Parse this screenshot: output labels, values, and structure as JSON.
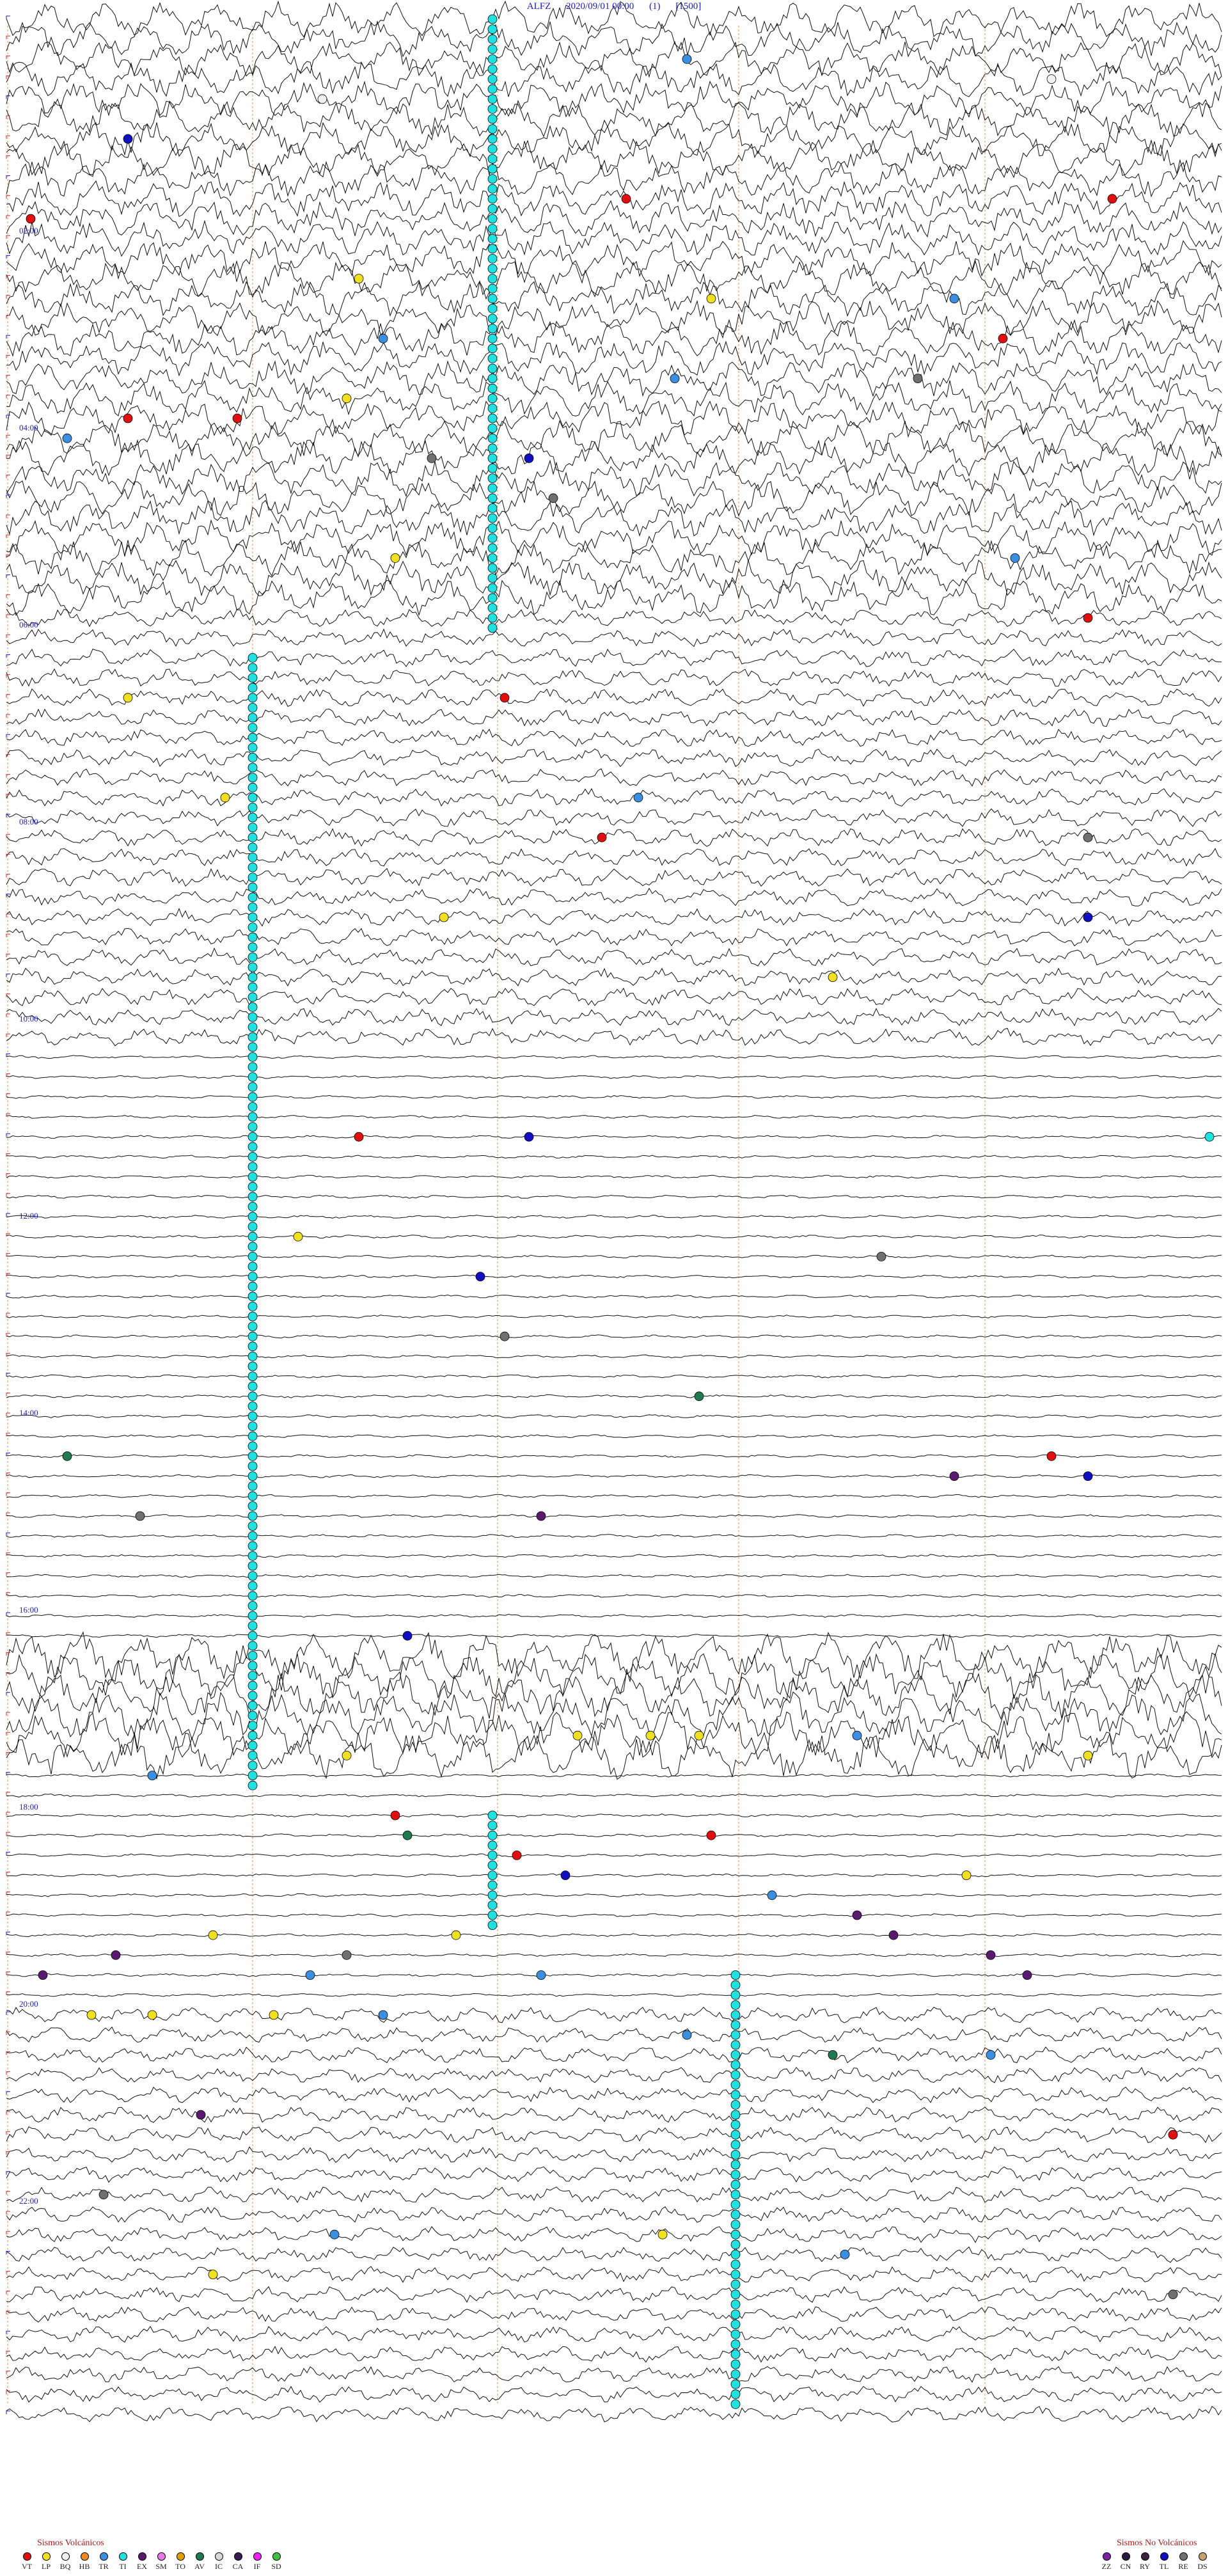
{
  "header": {
    "station": "ALFZ",
    "datetime": "2020/09/01 00:00",
    "channel": "(1)",
    "scale": "[1500]"
  },
  "chart_data": {
    "type": "helicorder",
    "rows": 96,
    "row_minutes": 15,
    "hour_labels": [
      "02:00",
      "04:00",
      "06:00",
      "08:00",
      "10:00",
      "12:00",
      "14:00",
      "16:00",
      "18:00",
      "20:00",
      "22:00"
    ],
    "marker_columns": 4,
    "event_colors": {
      "VT": "#e01010",
      "LP": "#f0e020",
      "BQ": "#f0f0f0",
      "HB": "#f08a20",
      "TR": "#3b8fe0",
      "TI": "#20e0e0",
      "EX": "#5a1a70",
      "SM": "#e878e8",
      "TO": "#e0a000",
      "AV": "#207a50",
      "IC": "#d8d8d8",
      "CA": "#3a1a50",
      "IF": "#f020f0",
      "SD": "#40c040",
      "ZZ": "#7a20a0",
      "CN": "#2a1a40",
      "RY": "#402040",
      "TL": "#1010c0",
      "RE": "#707070",
      "DS": "#c8a070"
    },
    "traces": [
      {
        "rows": [
          0,
          30
        ],
        "amp": 0.9
      },
      {
        "rows": [
          30,
          52
        ],
        "amp": 0.45
      },
      {
        "rows": [
          52,
          82
        ],
        "amp": 0.08
      },
      {
        "rows": [
          82,
          88
        ],
        "amp": 1.2
      },
      {
        "rows": [
          88,
          100
        ],
        "amp": 0.08
      },
      {
        "rows": [
          100,
          122
        ],
        "amp": 0.4
      }
    ],
    "cyan_runs": [
      {
        "rows": [
          0,
          31
        ],
        "col": 2
      },
      {
        "rows": [
          32,
          89
        ],
        "col": 1
      },
      {
        "rows": [
          90,
          96
        ],
        "col": 2
      },
      {
        "rows": [
          98,
          120
        ],
        "col": 3
      }
    ],
    "events": [
      {
        "row": 2,
        "t": 0.56,
        "c": "TR"
      },
      {
        "row": 3,
        "t": 0.86,
        "c": "BQ"
      },
      {
        "row": 4,
        "t": 0.26,
        "c": "BQ"
      },
      {
        "row": 6,
        "t": 0.1,
        "c": "TL"
      },
      {
        "row": 9,
        "t": 0.51,
        "c": "VT"
      },
      {
        "row": 9,
        "t": 0.91,
        "c": "VT"
      },
      {
        "row": 10,
        "t": 0.02,
        "c": "VT"
      },
      {
        "row": 13,
        "t": 0.29,
        "c": "LP"
      },
      {
        "row": 14,
        "t": 0.58,
        "c": "LP"
      },
      {
        "row": 14,
        "t": 0.78,
        "c": "TR"
      },
      {
        "row": 16,
        "t": 0.31,
        "c": "TR"
      },
      {
        "row": 16,
        "t": 0.82,
        "c": "VT"
      },
      {
        "row": 18,
        "t": 0.55,
        "c": "TR"
      },
      {
        "row": 18,
        "t": 0.75,
        "c": "RE"
      },
      {
        "row": 19,
        "t": 0.28,
        "c": "LP"
      },
      {
        "row": 20,
        "t": 0.1,
        "c": "VT"
      },
      {
        "row": 20,
        "t": 0.19,
        "c": "VT"
      },
      {
        "row": 21,
        "t": 0.05,
        "c": "TR"
      },
      {
        "row": 22,
        "t": 0.43,
        "c": "TL"
      },
      {
        "row": 22,
        "t": 0.35,
        "c": "RE"
      },
      {
        "row": 24,
        "t": 0.45,
        "c": "RE"
      },
      {
        "row": 27,
        "t": 0.32,
        "c": "LP"
      },
      {
        "row": 27,
        "t": 0.83,
        "c": "TR"
      },
      {
        "row": 30,
        "t": 0.89,
        "c": "VT"
      },
      {
        "row": 34,
        "t": 0.1,
        "c": "LP"
      },
      {
        "row": 34,
        "t": 0.41,
        "c": "VT"
      },
      {
        "row": 39,
        "t": 0.18,
        "c": "LP"
      },
      {
        "row": 39,
        "t": 0.52,
        "c": "TR"
      },
      {
        "row": 41,
        "t": 0.49,
        "c": "VT"
      },
      {
        "row": 41,
        "t": 0.89,
        "c": "RE"
      },
      {
        "row": 45,
        "t": 0.36,
        "c": "LP"
      },
      {
        "row": 45,
        "t": 0.89,
        "c": "TL"
      },
      {
        "row": 48,
        "t": 0.68,
        "c": "LP"
      },
      {
        "row": 56,
        "t": 0.29,
        "c": "VT"
      },
      {
        "row": 56,
        "t": 0.43,
        "c": "TL"
      },
      {
        "row": 56,
        "t": 0.99,
        "c": "TI"
      },
      {
        "row": 61,
        "t": 0.24,
        "c": "LP"
      },
      {
        "row": 62,
        "t": 0.72,
        "c": "RE"
      },
      {
        "row": 63,
        "t": 0.39,
        "c": "TL"
      },
      {
        "row": 66,
        "t": 0.41,
        "c": "RE"
      },
      {
        "row": 69,
        "t": 0.57,
        "c": "AV"
      },
      {
        "row": 72,
        "t": 0.05,
        "c": "AV"
      },
      {
        "row": 72,
        "t": 0.86,
        "c": "VT"
      },
      {
        "row": 73,
        "t": 0.78,
        "c": "EX"
      },
      {
        "row": 73,
        "t": 0.89,
        "c": "TL"
      },
      {
        "row": 75,
        "t": 0.11,
        "c": "RE"
      },
      {
        "row": 75,
        "t": 0.44,
        "c": "EX"
      },
      {
        "row": 81,
        "t": 0.33,
        "c": "TL"
      },
      {
        "row": 86,
        "t": 0.47,
        "c": "LP"
      },
      {
        "row": 86,
        "t": 0.53,
        "c": "LP"
      },
      {
        "row": 86,
        "t": 0.57,
        "c": "LP"
      },
      {
        "row": 86,
        "t": 0.7,
        "c": "TR"
      },
      {
        "row": 87,
        "t": 0.28,
        "c": "LP"
      },
      {
        "row": 87,
        "t": 0.89,
        "c": "LP"
      },
      {
        "row": 88,
        "t": 0.12,
        "c": "TR"
      },
      {
        "row": 90,
        "t": 0.32,
        "c": "VT"
      },
      {
        "row": 91,
        "t": 0.58,
        "c": "VT"
      },
      {
        "row": 91,
        "t": 0.33,
        "c": "AV"
      },
      {
        "row": 92,
        "t": 0.42,
        "c": "VT"
      },
      {
        "row": 93,
        "t": 0.46,
        "c": "TL"
      },
      {
        "row": 93,
        "t": 0.79,
        "c": "LP"
      },
      {
        "row": 94,
        "t": 0.63,
        "c": "TR"
      },
      {
        "row": 95,
        "t": 0.7,
        "c": "EX"
      },
      {
        "row": 96,
        "t": 0.17,
        "c": "LP"
      },
      {
        "row": 96,
        "t": 0.37,
        "c": "LP"
      },
      {
        "row": 96,
        "t": 0.73,
        "c": "EX"
      },
      {
        "row": 97,
        "t": 0.09,
        "c": "EX"
      },
      {
        "row": 97,
        "t": 0.28,
        "c": "RE"
      },
      {
        "row": 97,
        "t": 0.81,
        "c": "EX"
      },
      {
        "row": 98,
        "t": 0.03,
        "c": "EX"
      },
      {
        "row": 98,
        "t": 0.25,
        "c": "TR"
      },
      {
        "row": 98,
        "t": 0.44,
        "c": "TR"
      },
      {
        "row": 98,
        "t": 0.84,
        "c": "EX"
      },
      {
        "row": 100,
        "t": 0.07,
        "c": "LP"
      },
      {
        "row": 100,
        "t": 0.12,
        "c": "LP"
      },
      {
        "row": 100,
        "t": 0.22,
        "c": "LP"
      },
      {
        "row": 100,
        "t": 0.31,
        "c": "TR"
      },
      {
        "row": 101,
        "t": 0.56,
        "c": "TR"
      },
      {
        "row": 102,
        "t": 0.68,
        "c": "AV"
      },
      {
        "row": 102,
        "t": 0.81,
        "c": "TR"
      },
      {
        "row": 105,
        "t": 0.16,
        "c": "EX"
      },
      {
        "row": 106,
        "t": 0.96,
        "c": "VT"
      },
      {
        "row": 109,
        "t": 0.08,
        "c": "RE"
      },
      {
        "row": 111,
        "t": 0.27,
        "c": "TR"
      },
      {
        "row": 111,
        "t": 0.54,
        "c": "LP"
      },
      {
        "row": 112,
        "t": 0.69,
        "c": "TR"
      },
      {
        "row": 113,
        "t": 0.17,
        "c": "LP"
      },
      {
        "row": 114,
        "t": 0.96,
        "c": "RE"
      }
    ]
  },
  "legend_volcanic": {
    "title": "Sismos Volcánicos",
    "items": [
      {
        "code": "VT",
        "color": "#e01010"
      },
      {
        "code": "LP",
        "color": "#f0e020"
      },
      {
        "code": "BQ",
        "color": "#f0f0f0"
      },
      {
        "code": "HB",
        "color": "#f08a20"
      },
      {
        "code": "TR",
        "color": "#3b8fe0"
      },
      {
        "code": "TI",
        "color": "#20e0e0"
      },
      {
        "code": "EX",
        "color": "#5a1a70"
      },
      {
        "code": "SM",
        "color": "#e878e8"
      },
      {
        "code": "TO",
        "color": "#e0a000"
      },
      {
        "code": "AV",
        "color": "#207a50"
      },
      {
        "code": "IC",
        "color": "#d8d8d8"
      },
      {
        "code": "CA",
        "color": "#3a1a50"
      },
      {
        "code": "IF",
        "color": "#f020f0"
      },
      {
        "code": "SD",
        "color": "#40c040"
      }
    ]
  },
  "legend_nonvolcanic": {
    "title": "Sismos No Volcánicos",
    "items": [
      {
        "code": "ZZ",
        "color": "#7a20a0"
      },
      {
        "code": "CN",
        "color": "#2a1a40"
      },
      {
        "code": "RY",
        "color": "#402040"
      },
      {
        "code": "TL",
        "color": "#1010c0"
      },
      {
        "code": "RE",
        "color": "#707070"
      },
      {
        "code": "DS",
        "color": "#c8a070"
      }
    ]
  }
}
